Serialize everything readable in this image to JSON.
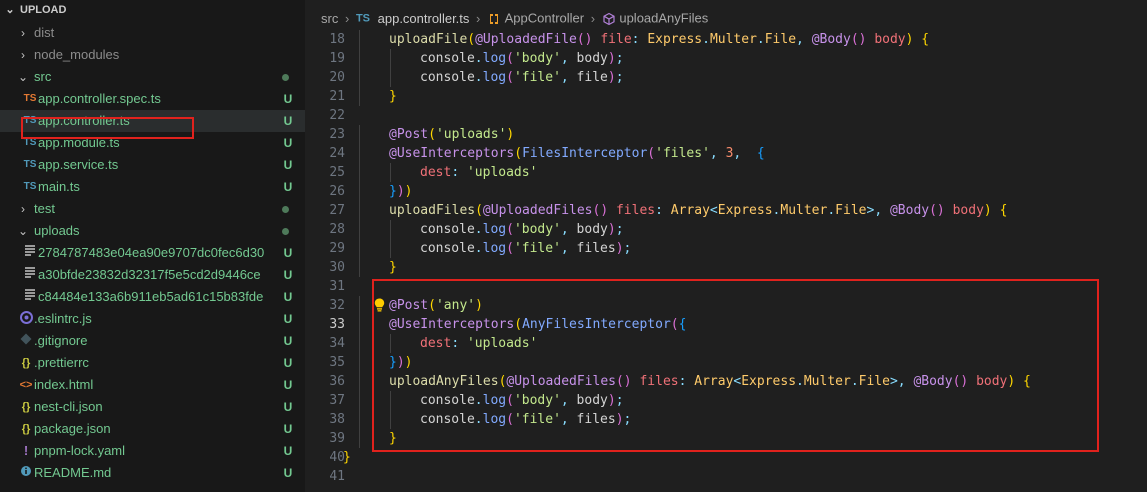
{
  "explorer": {
    "title": "UPLOAD",
    "items": [
      {
        "label": "dist",
        "kind": "folder",
        "expanded": false,
        "depth": 0,
        "color": "dim",
        "status": ""
      },
      {
        "label": "node_modules",
        "kind": "folder",
        "expanded": false,
        "depth": 0,
        "color": "dim",
        "status": ""
      },
      {
        "label": "src",
        "kind": "folder",
        "expanded": true,
        "depth": 0,
        "color": "green",
        "status": "dot"
      },
      {
        "label": "app.controller.spec.ts",
        "kind": "ts-orange",
        "depth": 1,
        "color": "green",
        "status": "U",
        "icon": "TS"
      },
      {
        "label": "app.controller.ts",
        "kind": "ts",
        "depth": 1,
        "color": "green",
        "status": "U",
        "icon": "TS",
        "selected": true
      },
      {
        "label": "app.module.ts",
        "kind": "ts",
        "depth": 1,
        "color": "green",
        "status": "U",
        "icon": "TS"
      },
      {
        "label": "app.service.ts",
        "kind": "ts",
        "depth": 1,
        "color": "green",
        "status": "U",
        "icon": "TS"
      },
      {
        "label": "main.ts",
        "kind": "ts",
        "depth": 1,
        "color": "green",
        "status": "U",
        "icon": "TS"
      },
      {
        "label": "test",
        "kind": "folder",
        "expanded": false,
        "depth": 0,
        "color": "green",
        "status": "dot"
      },
      {
        "label": "uploads",
        "kind": "folder",
        "expanded": true,
        "depth": 0,
        "color": "green",
        "status": "dot"
      },
      {
        "label": "2784787483e04ea90e9707dc0fec6d30",
        "kind": "text",
        "depth": 1,
        "color": "green",
        "status": "U"
      },
      {
        "label": "a30bfde23832d32317f5e5cd2d9446ce",
        "kind": "text",
        "depth": 1,
        "color": "green",
        "status": "U"
      },
      {
        "label": "c84484e133a6b911eb5ad61c15b83fde",
        "kind": "text",
        "depth": 1,
        "color": "green",
        "status": "U"
      },
      {
        "label": ".eslintrc.js",
        "kind": "eslint",
        "depth": 0,
        "color": "green",
        "status": "U"
      },
      {
        "label": ".gitignore",
        "kind": "git",
        "depth": 0,
        "color": "green",
        "status": "U"
      },
      {
        "label": ".prettierrc",
        "kind": "json",
        "depth": 0,
        "color": "green",
        "status": "U",
        "icon": "{}"
      },
      {
        "label": "index.html",
        "kind": "html",
        "depth": 0,
        "color": "green",
        "status": "U",
        "icon": "<>"
      },
      {
        "label": "nest-cli.json",
        "kind": "json",
        "depth": 0,
        "color": "green",
        "status": "U",
        "icon": "{}"
      },
      {
        "label": "package.json",
        "kind": "json",
        "depth": 0,
        "color": "green",
        "status": "U",
        "icon": "{}"
      },
      {
        "label": "pnpm-lock.yaml",
        "kind": "yaml",
        "depth": 0,
        "color": "green",
        "status": "U",
        "icon": "!"
      },
      {
        "label": "README.md",
        "kind": "md",
        "depth": 0,
        "color": "green",
        "status": "U"
      }
    ]
  },
  "breadcrumb": {
    "folder": "src",
    "file_icon": "TS",
    "file": "app.controller.ts",
    "class": "AppController",
    "method": "uploadAnyFiles"
  },
  "editor": {
    "active_line": 33,
    "lines": [
      {
        "n": "18",
        "indent": 1,
        "tokens": [
          [
            "fn",
            "uploadFile"
          ],
          [
            "b1",
            "("
          ],
          [
            "dec",
            "@UploadedFile"
          ],
          [
            "b2",
            "()"
          ],
          [
            "plain",
            " "
          ],
          [
            "var",
            "file"
          ],
          [
            "pun",
            ":"
          ],
          [
            "plain",
            " "
          ],
          [
            "type",
            "Express"
          ],
          [
            "pun",
            "."
          ],
          [
            "type",
            "Multer"
          ],
          [
            "pun",
            "."
          ],
          [
            "type",
            "File"
          ],
          [
            "pun",
            ","
          ],
          [
            "plain",
            " "
          ],
          [
            "dec",
            "@Body"
          ],
          [
            "b2",
            "()"
          ],
          [
            "plain",
            " "
          ],
          [
            "var",
            "body"
          ],
          [
            "b1",
            ")"
          ],
          [
            "plain",
            " "
          ],
          [
            "b1",
            "{"
          ]
        ]
      },
      {
        "n": "19",
        "indent": 2,
        "tokens": [
          [
            "plain",
            "console"
          ],
          [
            "pun",
            "."
          ],
          [
            "fn2",
            "log"
          ],
          [
            "b2",
            "("
          ],
          [
            "str",
            "'body'"
          ],
          [
            "pun",
            ","
          ],
          [
            "plain",
            " body"
          ],
          [
            "b2",
            ")"
          ],
          [
            "pun",
            ";"
          ]
        ]
      },
      {
        "n": "20",
        "indent": 2,
        "tokens": [
          [
            "plain",
            "console"
          ],
          [
            "pun",
            "."
          ],
          [
            "fn2",
            "log"
          ],
          [
            "b2",
            "("
          ],
          [
            "str",
            "'file'"
          ],
          [
            "pun",
            ","
          ],
          [
            "plain",
            " file"
          ],
          [
            "b2",
            ")"
          ],
          [
            "pun",
            ";"
          ]
        ]
      },
      {
        "n": "21",
        "indent": 1,
        "tokens": [
          [
            "b1",
            "}"
          ]
        ]
      },
      {
        "n": "22",
        "indent": 0,
        "tokens": []
      },
      {
        "n": "23",
        "indent": 1,
        "tokens": [
          [
            "dec",
            "@Post"
          ],
          [
            "b1",
            "("
          ],
          [
            "str",
            "'uploads'"
          ],
          [
            "b1",
            ")"
          ]
        ]
      },
      {
        "n": "24",
        "indent": 1,
        "tokens": [
          [
            "dec",
            "@UseInterceptors"
          ],
          [
            "b1",
            "("
          ],
          [
            "fn2",
            "FilesInterceptor"
          ],
          [
            "b2",
            "("
          ],
          [
            "str",
            "'files'"
          ],
          [
            "pun",
            ","
          ],
          [
            "plain",
            " "
          ],
          [
            "num",
            "3"
          ],
          [
            "pun",
            ","
          ],
          [
            "plain",
            "  "
          ],
          [
            "b3",
            "{"
          ]
        ]
      },
      {
        "n": "25",
        "indent": 2,
        "tokens": [
          [
            "var",
            "dest"
          ],
          [
            "pun",
            ":"
          ],
          [
            "plain",
            " "
          ],
          [
            "str",
            "'uploads'"
          ]
        ]
      },
      {
        "n": "26",
        "indent": 1,
        "tokens": [
          [
            "b3",
            "}"
          ],
          [
            "b2",
            ")"
          ],
          [
            "b1",
            ")"
          ]
        ]
      },
      {
        "n": "27",
        "indent": 1,
        "tokens": [
          [
            "fn",
            "uploadFiles"
          ],
          [
            "b1",
            "("
          ],
          [
            "dec",
            "@UploadedFiles"
          ],
          [
            "b2",
            "()"
          ],
          [
            "plain",
            " "
          ],
          [
            "var",
            "files"
          ],
          [
            "pun",
            ":"
          ],
          [
            "plain",
            " "
          ],
          [
            "type",
            "Array"
          ],
          [
            "pun",
            "<"
          ],
          [
            "type",
            "Express"
          ],
          [
            "pun",
            "."
          ],
          [
            "type",
            "Multer"
          ],
          [
            "pun",
            "."
          ],
          [
            "type",
            "File"
          ],
          [
            "pun",
            ">"
          ],
          [
            "pun",
            ","
          ],
          [
            "plain",
            " "
          ],
          [
            "dec",
            "@Body"
          ],
          [
            "b2",
            "()"
          ],
          [
            "plain",
            " "
          ],
          [
            "var",
            "body"
          ],
          [
            "b1",
            ")"
          ],
          [
            "plain",
            " "
          ],
          [
            "b1",
            "{"
          ]
        ]
      },
      {
        "n": "28",
        "indent": 2,
        "tokens": [
          [
            "plain",
            "console"
          ],
          [
            "pun",
            "."
          ],
          [
            "fn2",
            "log"
          ],
          [
            "b2",
            "("
          ],
          [
            "str",
            "'body'"
          ],
          [
            "pun",
            ","
          ],
          [
            "plain",
            " body"
          ],
          [
            "b2",
            ")"
          ],
          [
            "pun",
            ";"
          ]
        ]
      },
      {
        "n": "29",
        "indent": 2,
        "tokens": [
          [
            "plain",
            "console"
          ],
          [
            "pun",
            "."
          ],
          [
            "fn2",
            "log"
          ],
          [
            "b2",
            "("
          ],
          [
            "str",
            "'file'"
          ],
          [
            "pun",
            ","
          ],
          [
            "plain",
            " files"
          ],
          [
            "b2",
            ")"
          ],
          [
            "pun",
            ";"
          ]
        ]
      },
      {
        "n": "30",
        "indent": 1,
        "tokens": [
          [
            "b1",
            "}"
          ]
        ]
      },
      {
        "n": "31",
        "indent": 0,
        "tokens": []
      },
      {
        "n": "32",
        "indent": 1,
        "bulb": true,
        "tokens": [
          [
            "dec",
            "@Post"
          ],
          [
            "b1",
            "("
          ],
          [
            "str",
            "'any'"
          ],
          [
            "b1",
            ")"
          ]
        ]
      },
      {
        "n": "33",
        "indent": 1,
        "tokens": [
          [
            "dec",
            "@UseInterceptors"
          ],
          [
            "b1",
            "("
          ],
          [
            "fn2",
            "AnyFilesInterceptor"
          ],
          [
            "b2",
            "("
          ],
          [
            "b3",
            "{"
          ]
        ]
      },
      {
        "n": "34",
        "indent": 2,
        "tokens": [
          [
            "var",
            "dest"
          ],
          [
            "pun",
            ":"
          ],
          [
            "plain",
            " "
          ],
          [
            "str",
            "'uploads'"
          ]
        ]
      },
      {
        "n": "35",
        "indent": 1,
        "tokens": [
          [
            "b3",
            "}"
          ],
          [
            "b2",
            ")"
          ],
          [
            "b1",
            ")"
          ]
        ]
      },
      {
        "n": "36",
        "indent": 1,
        "tokens": [
          [
            "fn",
            "uploadAnyFiles"
          ],
          [
            "b1",
            "("
          ],
          [
            "dec",
            "@UploadedFiles"
          ],
          [
            "b2",
            "()"
          ],
          [
            "plain",
            " "
          ],
          [
            "var",
            "files"
          ],
          [
            "pun",
            ":"
          ],
          [
            "plain",
            " "
          ],
          [
            "type",
            "Array"
          ],
          [
            "pun",
            "<"
          ],
          [
            "type",
            "Express"
          ],
          [
            "pun",
            "."
          ],
          [
            "type",
            "Multer"
          ],
          [
            "pun",
            "."
          ],
          [
            "type",
            "File"
          ],
          [
            "pun",
            ">"
          ],
          [
            "pun",
            ","
          ],
          [
            "plain",
            " "
          ],
          [
            "dec",
            "@Body"
          ],
          [
            "b2",
            "()"
          ],
          [
            "plain",
            " "
          ],
          [
            "var",
            "body"
          ],
          [
            "b1",
            ")"
          ],
          [
            "plain",
            " "
          ],
          [
            "b1",
            "{"
          ]
        ]
      },
      {
        "n": "37",
        "indent": 2,
        "tokens": [
          [
            "plain",
            "console"
          ],
          [
            "pun",
            "."
          ],
          [
            "fn2",
            "log"
          ],
          [
            "b2",
            "("
          ],
          [
            "str",
            "'body'"
          ],
          [
            "pun",
            ","
          ],
          [
            "plain",
            " body"
          ],
          [
            "b2",
            ")"
          ],
          [
            "pun",
            ";"
          ]
        ]
      },
      {
        "n": "38",
        "indent": 2,
        "tokens": [
          [
            "plain",
            "console"
          ],
          [
            "pun",
            "."
          ],
          [
            "fn2",
            "log"
          ],
          [
            "b2",
            "("
          ],
          [
            "str",
            "'file'"
          ],
          [
            "pun",
            ","
          ],
          [
            "plain",
            " files"
          ],
          [
            "b2",
            ")"
          ],
          [
            "pun",
            ";"
          ]
        ]
      },
      {
        "n": "39",
        "indent": 1,
        "tokens": [
          [
            "b1",
            "}"
          ]
        ]
      },
      {
        "n": "40",
        "indent": 0,
        "tokens": [
          [
            "b1",
            "}"
          ]
        ]
      },
      {
        "n": "41",
        "indent": 0,
        "tokens": []
      }
    ]
  }
}
